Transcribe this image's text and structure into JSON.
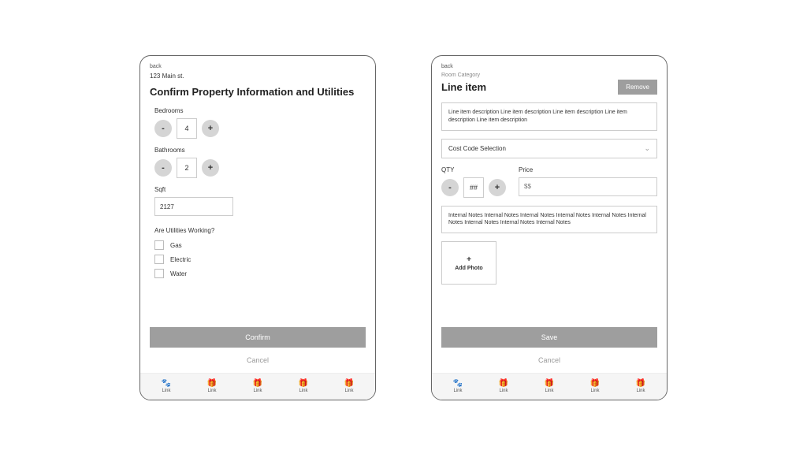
{
  "left": {
    "back": "back",
    "address": "123 Main st.",
    "title": "Confirm Property Information and Utilities",
    "bedrooms": {
      "label": "Bedrooms",
      "value": "4"
    },
    "bathrooms": {
      "label": "Bathrooms",
      "value": "2"
    },
    "sqft": {
      "label": "Sqft",
      "value": "2127"
    },
    "utilities_question": "Are Utilities Working?",
    "utilities": [
      {
        "label": "Gas"
      },
      {
        "label": "Electric"
      },
      {
        "label": "Water"
      }
    ],
    "confirm": "Confirm",
    "cancel": "Cancel"
  },
  "right": {
    "back": "back",
    "subtitle": "Room Category",
    "title": "Line item",
    "remove": "Remove",
    "description": "Line item description Line item description Line item description Line item description Line item description",
    "cost_code": "Cost Code Selection",
    "qty": {
      "label": "QTY",
      "value": "##"
    },
    "price": {
      "label": "Price",
      "placeholder": "$$"
    },
    "notes": "Internal Notes Internal Notes Internal Notes Internal Notes Internal Notes Internal Notes Internal Notes Internal Notes Internal Notes",
    "add_photo": "Add Photo",
    "save": "Save",
    "cancel": "Cancel"
  },
  "tabs": [
    {
      "label": "Link"
    },
    {
      "label": "Link"
    },
    {
      "label": "Link"
    },
    {
      "label": "Link"
    },
    {
      "label": "Link"
    }
  ],
  "stepper": {
    "minus": "-",
    "plus": "+"
  },
  "plus_symbol": "+"
}
